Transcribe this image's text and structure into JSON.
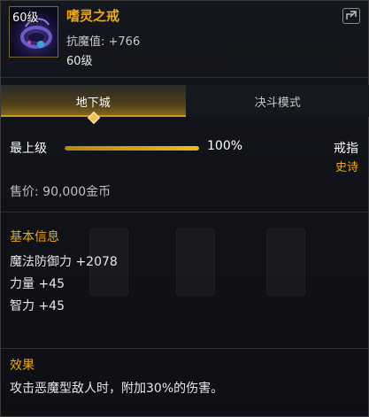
{
  "header": {
    "icon_badge": "60级",
    "icon_name": "ring-icon",
    "name": "嗜灵之戒",
    "sub_stat": "抗魔值: +766",
    "level": "60级",
    "share_icon": "share-icon"
  },
  "tabs": [
    {
      "label": "地下城",
      "active": true
    },
    {
      "label": "决斗模式",
      "active": false
    }
  ],
  "level_row": {
    "label": "最上级",
    "percent_text": "100%",
    "progress": 1.0,
    "type": "戒指",
    "rarity": "史诗"
  },
  "price": "售价: 90,000金币",
  "basic_info": {
    "title": "基本信息",
    "stats": [
      "魔法防御力 +2078",
      "力量 +45",
      "智力 +45"
    ]
  },
  "effect": {
    "title": "效果",
    "text": "攻击恶魔型敌人时，附加30%的伤害。"
  },
  "colors": {
    "accent": "#f2a900",
    "tab_active": "#8a6d1d",
    "background": "#111319"
  }
}
